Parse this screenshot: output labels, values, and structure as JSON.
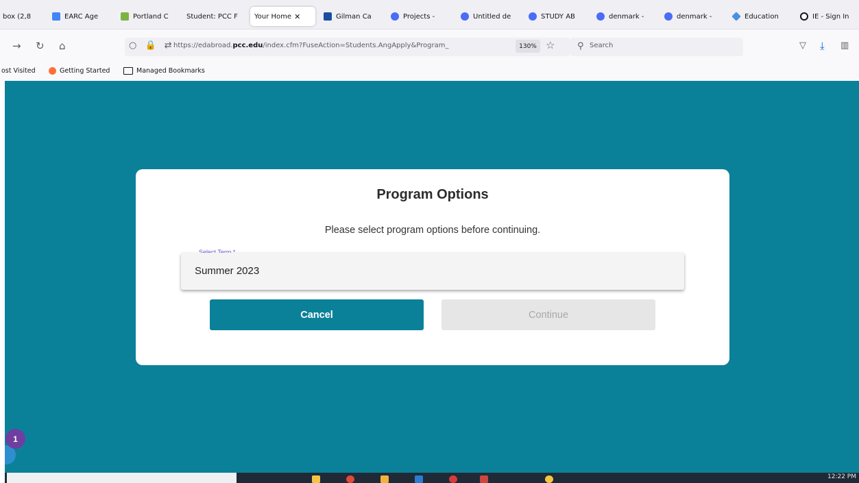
{
  "browser": {
    "tabs": [
      {
        "title": "box (2,8",
        "fav_color": "#d93025",
        "fav_shape": "square",
        "active": false
      },
      {
        "title": "EARC Age",
        "fav_color": "#4285f4",
        "fav_shape": "square",
        "active": false
      },
      {
        "title": "Portland C",
        "fav_color": "#7cb342",
        "fav_shape": "square",
        "active": false
      },
      {
        "title": "Student: PCC F",
        "fav_color": "",
        "fav_shape": "none",
        "active": false
      },
      {
        "title": "Your Home",
        "fav_color": "",
        "fav_shape": "none",
        "active": true
      },
      {
        "title": "Gilman Ca",
        "fav_color": "#1a4ea1",
        "fav_shape": "square",
        "active": false
      },
      {
        "title": "Projects - ",
        "fav_color": "#4a6cf7",
        "fav_shape": "circle",
        "active": false
      },
      {
        "title": "Untitled de",
        "fav_color": "#4a6cf7",
        "fav_shape": "circle",
        "active": false
      },
      {
        "title": "STUDY AB",
        "fav_color": "#4a6cf7",
        "fav_shape": "circle",
        "active": false
      },
      {
        "title": "denmark -",
        "fav_color": "#4a6cf7",
        "fav_shape": "circle",
        "active": false
      },
      {
        "title": "denmark -",
        "fav_color": "#4a6cf7",
        "fav_shape": "circle",
        "active": false
      },
      {
        "title": "Education",
        "fav_color": "#4a90e2",
        "fav_shape": "diamond",
        "active": false
      },
      {
        "title": "IE - Sign In",
        "fav_color": "#15141a",
        "fav_shape": "circle",
        "active": false
      }
    ],
    "url_prefix": "https://edabroad.",
    "url_domain": "pcc.edu",
    "url_path": "/index.cfm?FuseAction=Students.AngApply&Program_",
    "zoom": "130%",
    "search_placeholder": "Search",
    "bookmarks": [
      "ost Visited",
      "Getting Started",
      "Managed Bookmarks"
    ]
  },
  "modal": {
    "title": "Program Options",
    "subtitle": "Please select program options before continuing.",
    "term_label": "Select Term *",
    "term_value": "Summer 2023",
    "cancel_label": "Cancel",
    "continue_label": "Continue"
  },
  "notification_badge": "1",
  "taskbar": {
    "clock": "12:22 PM"
  },
  "colors": {
    "page_bg": "#0b8199",
    "primary_button": "#0b8199",
    "disabled_button": "#e6e6e6",
    "badge": "#6f3ea0"
  }
}
